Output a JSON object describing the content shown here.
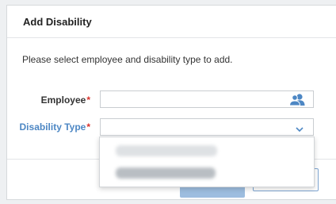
{
  "dialog": {
    "title": "Add Disability",
    "instructions": "Please select employee and disability type to add."
  },
  "form": {
    "employee": {
      "label": "Employee",
      "required_marker": "*",
      "value": "",
      "icon": "user-group-icon"
    },
    "disability_type": {
      "label": "Disability Type",
      "required_marker": "*",
      "value": "",
      "icon": "chevron-down-icon"
    }
  },
  "dropdown": {
    "options": [
      "",
      ""
    ]
  },
  "colors": {
    "accent": "#4d87c4",
    "required": "#d9312b"
  }
}
